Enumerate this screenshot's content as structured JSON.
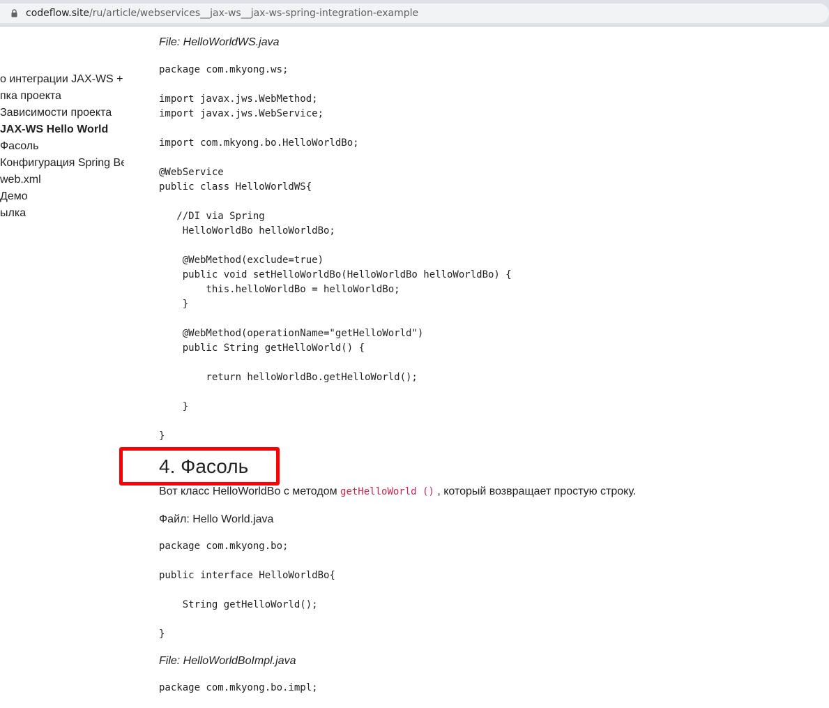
{
  "browser": {
    "url_host": "codeflow.site",
    "url_path": "/ru/article/webservices__jax-ws__jax-ws-spring-integration-example"
  },
  "toc": {
    "items": [
      "о интеграции JAX-WS + S",
      "пка проекта",
      "Зависимости проекта",
      "JAX-WS Hello World",
      "Фасоль",
      "Конфигурация Spring Be",
      "web.xml",
      "Демо",
      "ылка"
    ],
    "active_index": 3
  },
  "article": {
    "file1_label": "File: HelloWorldWS.java",
    "code1": "package com.mkyong.ws;\n\nimport javax.jws.WebMethod;\nimport javax.jws.WebService;\n\nimport com.mkyong.bo.HelloWorldBo;\n\n@WebService\npublic class HelloWorldWS{\n\n   //DI via Spring\n    HelloWorldBo helloWorldBo;\n\n    @WebMethod(exclude=true)\n    public void setHelloWorldBo(HelloWorldBo helloWorldBo) {\n        this.helloWorldBo = helloWorldBo;\n    }\n\n    @WebMethod(operationName=\"getHelloWorld\")\n    public String getHelloWorld() {\n\n        return helloWorldBo.getHelloWorld();\n\n    }\n\n}",
    "heading": "4. Фасоль",
    "para_before": "Вот класс HelloWorldBo с методом ",
    "para_code": "getHelloWorld ()",
    "para_after": " , который возвращает простую строку.",
    "file2_label": "Файл: Hello World.java",
    "code2": "package com.mkyong.bo;\n\npublic interface HelloWorldBo{\n\n    String getHelloWorld();\n\n}",
    "file3_label": "File: HelloWorldBoImpl.java",
    "code3": "package com.mkyong.bo.impl;"
  },
  "colors": {
    "highlight_box": "#ff0000",
    "inline_code": "#c7254e"
  }
}
